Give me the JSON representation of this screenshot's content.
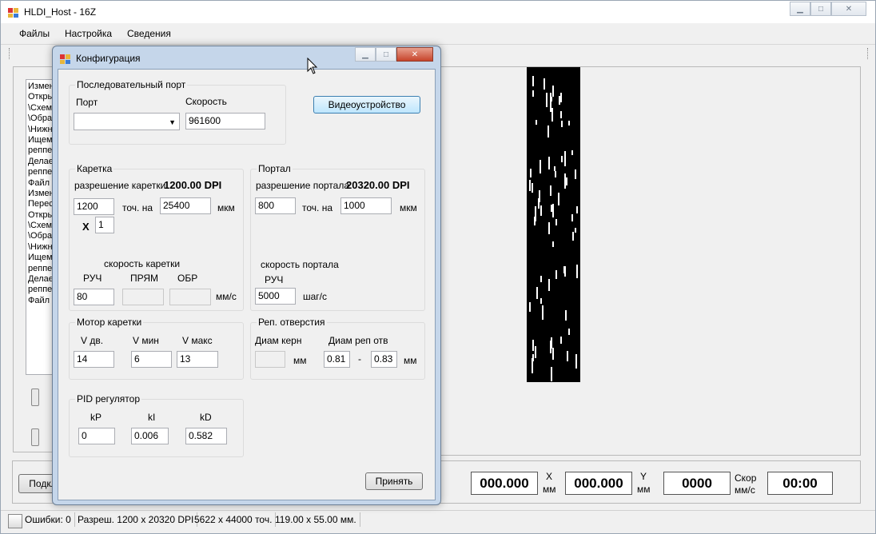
{
  "window": {
    "title": "HLDI_Host - 16Z",
    "menu": [
      "Файлы",
      "Настройка",
      "Сведения"
    ]
  },
  "log_lines": [
    "Измен",
    "Откры",
    "\\Схеми",
    "\\Обрат",
    "\\Нижн",
    "Ищем",
    "реппер",
    "Делае",
    "реппер",
    "Файл",
    "Измен",
    "Пересо",
    "Откры",
    "\\Схеми",
    "\\Обрат",
    "\\Нижн",
    "Ищем",
    "реппер",
    "Делае",
    "реппер",
    "Файл"
  ],
  "connect_button": "Подкл",
  "readouts": {
    "x_value": "000.000",
    "x_label": "X",
    "x_unit": "мм",
    "y_value": "000.000",
    "y_label": "Y",
    "y_unit": "мм",
    "speed_value": "0000",
    "speed_label": "Скор",
    "speed_unit": "мм/с",
    "time_value": "00:00"
  },
  "status": {
    "errors": "Ошибки: 0",
    "resolution": "Разреш. 1200 x 20320 DPI",
    "points": "5622 x 44000 точ.",
    "size_mm": "119.00 x 55.00 мм."
  },
  "dialog": {
    "title": "Конфигурация",
    "serial": {
      "group": "Последовательный порт",
      "port_label": "Порт",
      "port_value": "",
      "speed_label": "Скорость",
      "speed_value": "961600"
    },
    "video_button": "Видеоустройство",
    "carriage": {
      "group": "Каретка",
      "res_label": "разрешение каретки",
      "res_value": "1200.00 DPI",
      "points": "1200",
      "points_unit": "точ. на",
      "microns": "25400",
      "microns_unit": "мкм",
      "mult_label": "X",
      "mult_value": "1",
      "speed_title": "скорость каретки",
      "col_manual": "РУЧ",
      "col_forward": "ПРЯМ",
      "col_back": "ОБР",
      "manual_value": "80",
      "forward_value": "",
      "back_value": "",
      "speed_unit": "мм/с"
    },
    "portal": {
      "group": "Портал",
      "res_label": "разрешение портала",
      "res_value": "20320.00 DPI",
      "points": "800",
      "points_unit": "точ. на",
      "microns": "1000",
      "microns_unit": "мкм",
      "speed_title": "скорость портала",
      "col_manual": "РУЧ",
      "manual_value": "5000",
      "speed_unit": "шаг/с"
    },
    "motor": {
      "group": "Мотор каретки",
      "v_start_label": "V дв.",
      "v_min_label": "V мин",
      "v_max_label": "V макс",
      "v_start": "14",
      "v_min": "6",
      "v_max": "13"
    },
    "ref_hole": {
      "group": "Реп. отверстия",
      "core_label": "Диам керн",
      "core_value": "",
      "core_unit": "мм",
      "hole_label": "Диам реп отв",
      "hole_min": "0.81",
      "dash": "-",
      "hole_max": "0.83",
      "hole_unit": "мм"
    },
    "pid": {
      "group": "PID регулятор",
      "kp_label": "kP",
      "ki_label": "kI",
      "kd_label": "kD",
      "kp": "0",
      "ki": "0.006",
      "kd": "0.582"
    },
    "accept_button": "Принять"
  }
}
